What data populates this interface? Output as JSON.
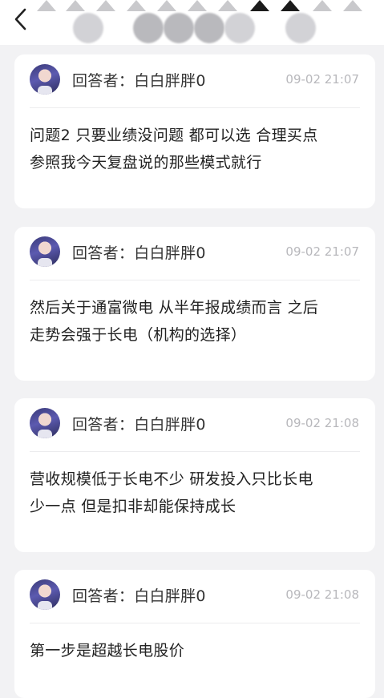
{
  "header": {
    "back_icon": "chevron-left-icon"
  },
  "answers": [
    {
      "author_prefix": "回答者：",
      "author_name": "白白胖胖0",
      "time": "09-02 21:07",
      "lines": [
        "问题2 只要业绩没问题 都可以选 合理买点",
        "参照我今天复盘说的那些模式就行"
      ]
    },
    {
      "author_prefix": "回答者：",
      "author_name": "白白胖胖0",
      "time": "09-02 21:07",
      "lines": [
        "然后关于通富微电 从半年报成绩而言 之后",
        "走势会强于长电（机构的选择）"
      ]
    },
    {
      "author_prefix": "回答者：",
      "author_name": "白白胖胖0",
      "time": "09-02 21:08",
      "lines": [
        "营收规模低于长电不少 研发投入只比长电",
        "少一点 但是扣非却能保持成长"
      ]
    },
    {
      "author_prefix": "回答者：",
      "author_name": "白白胖胖0",
      "time": "09-02 21:08",
      "lines": [
        "第一步是超越长电股价"
      ]
    }
  ],
  "colors": {
    "background": "#f2f2f4",
    "card": "#ffffff",
    "time_text": "#b8b8bc",
    "body_text": "#222222"
  }
}
